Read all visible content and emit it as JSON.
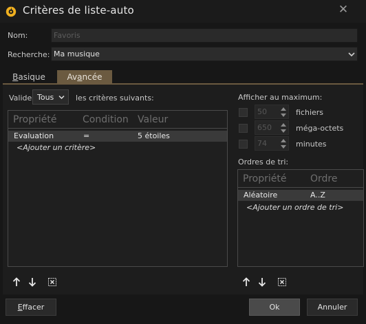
{
  "window": {
    "title": "Critères de liste-auto",
    "close_icon": "close-icon"
  },
  "form": {
    "name_label": "Nom:",
    "name_value": "Favoris",
    "search_label": "Recherche:",
    "search_value": "Ma musique"
  },
  "tabs": [
    {
      "label_first": "B",
      "label_rest": "asique",
      "active": false
    },
    {
      "label_first": "Av",
      "label_u": "a",
      "label_rest": "ncée",
      "active": true
    }
  ],
  "criteria": {
    "valid_label": "Valide",
    "match_value": "Tous",
    "suffix_label": "les critères suivants:",
    "columns": [
      "Propriété",
      "Condition",
      "Valeur"
    ],
    "rows": [
      {
        "property": "Evaluation",
        "condition": "=",
        "value": "5 étoiles"
      }
    ],
    "add_link": "<Ajouter un critère>"
  },
  "limits": {
    "heading": "Afficher au maximum:",
    "items": [
      {
        "value": "50",
        "unit": "fichiers",
        "checked": false
      },
      {
        "value": "650",
        "unit": "méga-octets",
        "checked": false
      },
      {
        "value": "74",
        "unit": "minutes",
        "checked": false
      }
    ]
  },
  "sort": {
    "heading": "Ordres de tri:",
    "columns": [
      "Propriété",
      "Ordre"
    ],
    "rows": [
      {
        "property": "Aléatoire",
        "order": "A..Z"
      }
    ],
    "add_link": "<Ajouter un ordre de tri>"
  },
  "buttons": {
    "clear_first": "E",
    "clear_rest": "ffacer",
    "ok": "Ok",
    "cancel": "Annuler"
  },
  "colors": {
    "accent": "#6b5a40",
    "background": "#171717",
    "logo": "#f0b020"
  }
}
